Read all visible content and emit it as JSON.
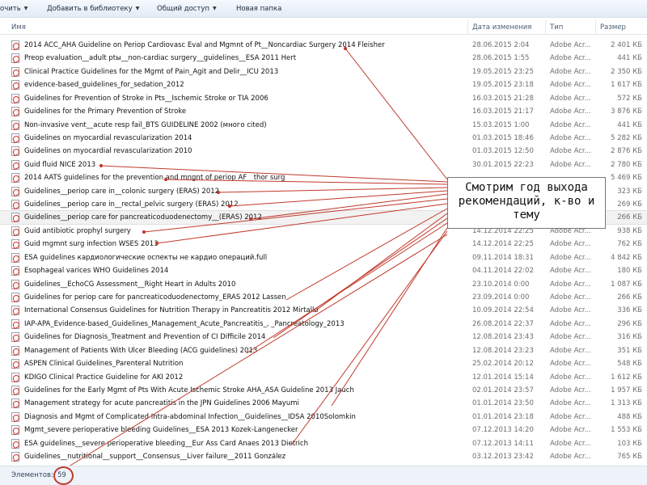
{
  "toolbar": {
    "items": [
      {
        "label": "очить",
        "dropdown": true
      },
      {
        "label": "Добавить в библиотеку",
        "dropdown": true
      },
      {
        "label": "Общий доступ",
        "dropdown": true
      },
      {
        "label": "Новая папка",
        "dropdown": false
      }
    ]
  },
  "columns": {
    "name": "Имя",
    "date": "Дата изменения",
    "type": "Тип",
    "size": "Размер"
  },
  "files": [
    {
      "name": "2014 ACC_AHA Guideline on Periop Cardiovasc Eval and Mgmnt of Pt__Noncardiac Surgery 2014 Fleisher",
      "date": "28.06.2015 2:04",
      "type": "Adobe Acr...",
      "size": "2 401 КБ"
    },
    {
      "name": "Preop evaluation__adult ptы__non-cardiac surgery__guidelines__ESA 2011 Hert",
      "date": "28.06.2015 1:55",
      "type": "Adobe Acr...",
      "size": "441 КБ"
    },
    {
      "name": "Clinical Practice Guidelines for the Mgmt of Pain_Agit and Delir__ICU 2013",
      "date": "19.05.2015 23:25",
      "type": "Adobe Acr...",
      "size": "2 350 КБ"
    },
    {
      "name": "evidence-based_guidelines_for_sedation_2012",
      "date": "19.05.2015 23:18",
      "type": "Adobe Acr...",
      "size": "1 617 КБ"
    },
    {
      "name": "Guidelines for Prevention of Stroke in Pts__Ischemic Stroke or TIA 2006",
      "date": "16.03.2015 21:28",
      "type": "Adobe Acr...",
      "size": "572 КБ"
    },
    {
      "name": "Guidelines for the Primary Prevention of Stroke",
      "date": "16.03.2015 21:17",
      "type": "Adobe Acr...",
      "size": "3 876 КБ"
    },
    {
      "name": "Non-invasive vent__acute resp fail_BTS GUIDELINE 2002 (много cited)",
      "date": "15.03.2015 1:00",
      "type": "Adobe Acr...",
      "size": "441 КБ"
    },
    {
      "name": "Guidelines on myocardial revascularization 2014",
      "date": "01.03.2015 18:46",
      "type": "Adobe Acr...",
      "size": "5 282 КБ"
    },
    {
      "name": "Guidelines on myocardial revascularization 2010",
      "date": "01.03.2015 12:50",
      "type": "Adobe Acr...",
      "size": "2 876 КБ"
    },
    {
      "name": "Guid fluid NICE 2013",
      "date": "30.01.2015 22:23",
      "type": "Adobe Acr...",
      "size": "2 780 КБ"
    },
    {
      "name": "2014 AATS guidelines for the prevention and mngnt of  periop AF__thor surg",
      "date": "",
      "type": "",
      "size": "5 469 КБ"
    },
    {
      "name": "Guidelines__periop care in__colonic surgery (ERAS) 2012",
      "date": "",
      "type": "",
      "size": "323 КБ"
    },
    {
      "name": "Guidelines__periop care in__rectal_pelvic surgery (ERAS) 2012",
      "date": "",
      "type": "",
      "size": "269 КБ"
    },
    {
      "name": "Guidelines__periop care for pancreaticoduodenectomy__(ERAS) 2012",
      "date": "",
      "type": "",
      "size": "266 КБ",
      "selected": true
    },
    {
      "name": "Guid antibiotic prophyl surgery",
      "date": "14.12.2014 22:25",
      "type": "Adobe Acr...",
      "size": "938 КБ"
    },
    {
      "name": "Guid mgmnt surg infection WSES 2013",
      "date": "14.12.2014 22:25",
      "type": "Adobe Acr...",
      "size": "762 КБ"
    },
    {
      "name": "ESA guidelines кардиологические оспекты не кардио операций.full",
      "date": "09.11.2014 18:31",
      "type": "Adobe Acr...",
      "size": "4 842 КБ"
    },
    {
      "name": "Esophageal varices WHO Guidelines 2014",
      "date": "04.11.2014 22:02",
      "type": "Adobe Acr...",
      "size": "180 КБ"
    },
    {
      "name": "Guidelines__EchoCG Assessment__Right Heart in Adults 2010",
      "date": "23.10.2014 0:00",
      "type": "Adobe Acr...",
      "size": "1 087 КБ"
    },
    {
      "name": "Guidelines for periop care for pancreaticoduodenectomy_ERAS 2012 Lassen",
      "date": "23.09.2014 0:00",
      "type": "Adobe Acr...",
      "size": "266 КБ"
    },
    {
      "name": "International Consensus Guidelines for Nutrition Therapy in Pancreatitis 2012 Mirtallo",
      "date": "10.09.2014 22:54",
      "type": "Adobe Acr...",
      "size": "336 КБ"
    },
    {
      "name": "IAP-APA_Evidence-based_Guidelines_Management_Acute_Pancreatitis_, _Pancreatology_2013",
      "date": "26.08.2014 22:37",
      "type": "Adobe Acr...",
      "size": "296 КБ"
    },
    {
      "name": "Guidelines for Diagnosis_Treatment and Prevention of CI Difficile 2014",
      "date": "12.08.2014 23:43",
      "type": "Adobe Acr...",
      "size": "316 КБ"
    },
    {
      "name": "Management of Patients With Ulcer Bleeding (ACG guidelines) 2013",
      "date": "12.08.2014 23:23",
      "type": "Adobe Acr...",
      "size": "351 КБ"
    },
    {
      "name": "ASPEN Clinical Guidelines_Parenteral Nutrition",
      "date": "25.02.2014 20:12",
      "type": "Adobe Acr...",
      "size": "548 КБ"
    },
    {
      "name": "KDIGO Clinical Practice Guideline for AKI 2012",
      "date": "12.01.2014 15:14",
      "type": "Adobe Acr...",
      "size": "1 612 КБ"
    },
    {
      "name": "Guidelines for the Early Mgmt of Pts With Acute Ischemic Stroke AHA_ASA Guideline 2013 Jauch",
      "date": "02.01.2014 23:57",
      "type": "Adobe Acr...",
      "size": "1 957 КБ"
    },
    {
      "name": "Management strategy for acute pancreatitis in the JPN Guidelines 2006 Mayumi",
      "date": "01.01.2014 23:50",
      "type": "Adobe Acr...",
      "size": "1 313 КБ"
    },
    {
      "name": "Diagnosis and Mgmt of Complicated Intra-abdominal Infection__Guidelines__IDSA 2010Solomkin",
      "date": "01.01.2014 23:18",
      "type": "Adobe Acr...",
      "size": "488 КБ"
    },
    {
      "name": "Mgmt_severe perioperative bleeding Guidelines__ESA 2013 Kozek-Langenecker",
      "date": "07.12.2013 14:20",
      "type": "Adobe Acr...",
      "size": "1 553 КБ"
    },
    {
      "name": "ESA guidelines__severe perioperative bleeding__Eur Ass Card Anaes 2013 Dietrich",
      "date": "07.12.2013 14:11",
      "type": "Adobe Acr...",
      "size": "103 КБ"
    },
    {
      "name": "Guidelines__nutritional__support__Consensus__Liver failure__2011 González",
      "date": "03.12.2013 23:42",
      "type": "Adobe Acr...",
      "size": "765 КБ"
    }
  ],
  "callout": {
    "text": "Смотрим год выхода рекомендаций, к-во и тему"
  },
  "annotation_colors": {
    "arrow": "#c0392b",
    "count_circle": "#c0392b"
  },
  "status": {
    "label": "Элементов:",
    "count": "59"
  }
}
